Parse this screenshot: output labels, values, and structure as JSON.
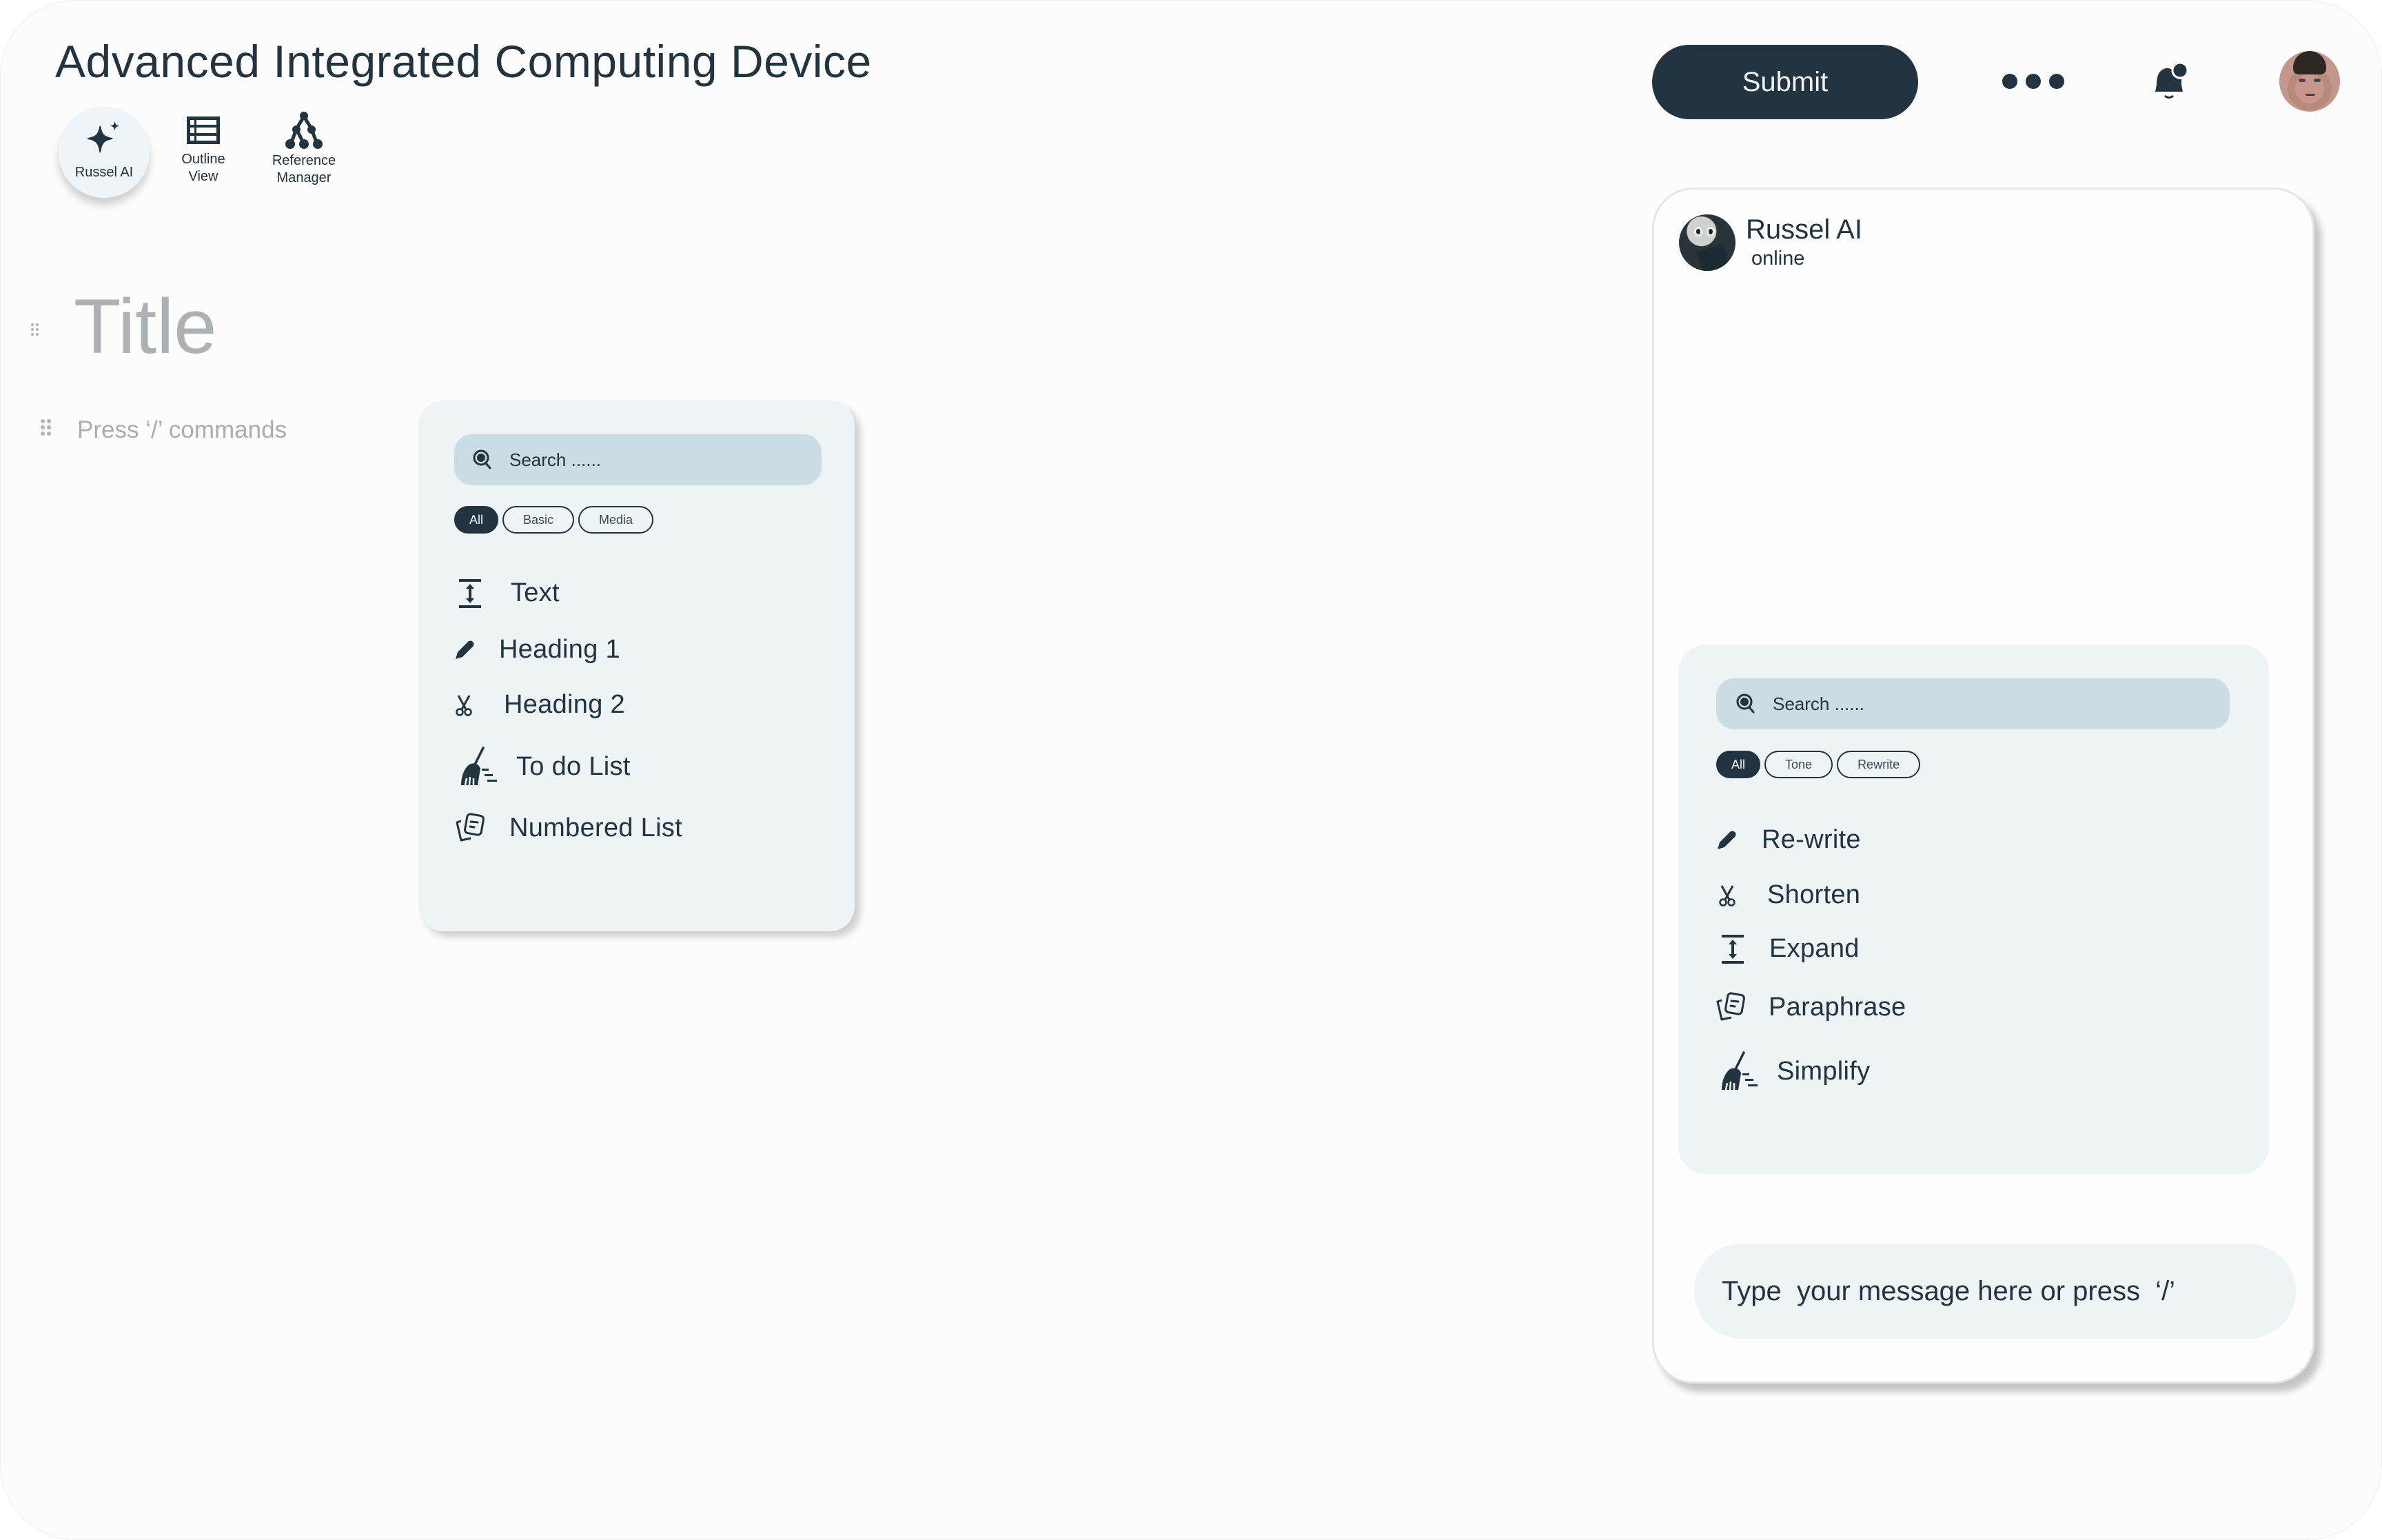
{
  "header": {
    "app_title": "Advanced Integrated Computing Device",
    "toolbar": [
      {
        "id": "russel-ai",
        "label": "Russel AI",
        "icon": "sparkle-icon",
        "active": true
      },
      {
        "id": "outline-view",
        "label": "Outline View",
        "icon": "list-icon",
        "active": false
      },
      {
        "id": "reference-manager",
        "label": "Reference Manager",
        "icon": "tree-icon",
        "active": false
      }
    ],
    "submit_label": "Submit",
    "more_icon": "more-horizontal-icon",
    "notification_icon": "bell-with-badge-icon",
    "user_avatar": "user-avatar"
  },
  "editor": {
    "title_placeholder": "Title",
    "command_placeholder": "Press ‘/’ commands"
  },
  "block_menu": {
    "search_placeholder": "Search ......",
    "filters": [
      {
        "label": "All",
        "active": true
      },
      {
        "label": "Basic",
        "active": false
      },
      {
        "label": "Media",
        "active": false
      }
    ],
    "items": [
      {
        "label": "Text",
        "icon": "expand-vertical-icon"
      },
      {
        "label": "Heading 1",
        "icon": "pencil-icon"
      },
      {
        "label": "Heading 2",
        "icon": "scissors-icon"
      },
      {
        "label": "To do List",
        "icon": "broom-icon"
      },
      {
        "label": "Numbered List",
        "icon": "cards-icon"
      }
    ]
  },
  "chat": {
    "bot_name": "Russel AI",
    "bot_status": "online",
    "ai_menu": {
      "search_placeholder": "Search ......",
      "filters": [
        {
          "label": "All",
          "active": true
        },
        {
          "label": "Tone",
          "active": false
        },
        {
          "label": "Rewrite",
          "active": false
        }
      ],
      "items": [
        {
          "label": "Re-write",
          "icon": "pencil-icon"
        },
        {
          "label": "Shorten",
          "icon": "scissors-icon"
        },
        {
          "label": "Expand",
          "icon": "expand-vertical-icon"
        },
        {
          "label": "Paraphrase",
          "icon": "cards-icon"
        },
        {
          "label": "Simplify",
          "icon": "broom-icon"
        }
      ]
    },
    "input_placeholder": "Type  your message here or press  ‘/’"
  },
  "colors": {
    "primary": "#213440",
    "search_bg": "#cbdce4",
    "panel_bg": "#eef3f6",
    "placeholder_gray": "#aeb1b3"
  }
}
